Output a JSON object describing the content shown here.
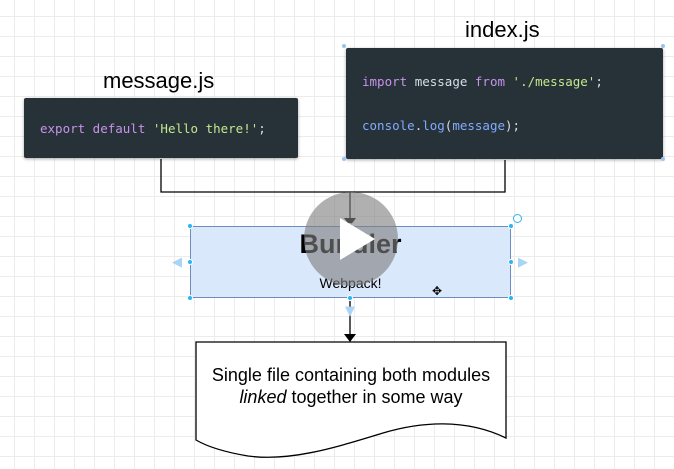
{
  "files": {
    "message": {
      "title": "message.js",
      "code": {
        "kw": "export default",
        "str": "'Hello there!'",
        "end": ";"
      }
    },
    "index": {
      "title": "index.js",
      "line1": {
        "kw1": "import",
        "id": "message",
        "kw2": "from",
        "str": "'./message'",
        "end": ";"
      },
      "line2": {
        "obj": "console",
        "dot": ".",
        "fn": "log",
        "open": "(",
        "arg": "message",
        "close": ");"
      }
    }
  },
  "bundler": {
    "title": "Bundler",
    "subtitle": "Webpack!"
  },
  "output": {
    "line1": "Single file containing both modules",
    "emphasis": "linked",
    "rest": " together in some way"
  },
  "icons": {
    "play": "play-icon",
    "rotate": "rotate-handle-icon",
    "move": "move-cursor-icon"
  },
  "colors": {
    "code_bg": "#263238",
    "keyword": "#c792ea",
    "string": "#c3e88d",
    "function": "#82aaff",
    "identifier": "#d8dee9",
    "bundler_fill": "#dae8fc",
    "bundler_border": "#6c8ebf",
    "selection_handle": "#29b6f2",
    "connector": "#000000"
  }
}
